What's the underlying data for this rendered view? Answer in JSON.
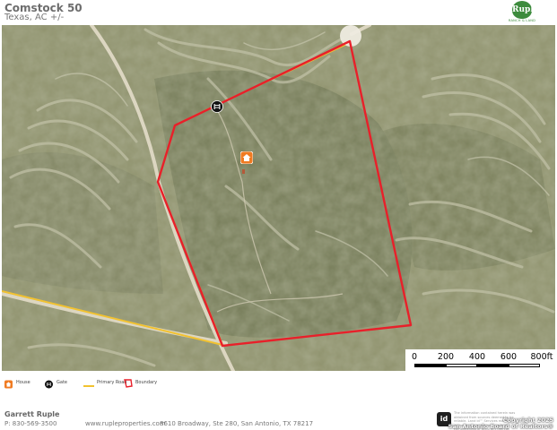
{
  "header": {
    "title": "Comstock 50",
    "subtitle": "Texas,  AC +/-",
    "logo_mark": "Ruple",
    "logo_sub": "RANCH & LAND"
  },
  "map": {
    "scale_labels": [
      "0",
      "200",
      "400",
      "600",
      "800ft"
    ],
    "markers": [
      {
        "type": "house",
        "icon": "house-icon"
      },
      {
        "type": "gate",
        "icon": "gate-icon"
      }
    ]
  },
  "legend": {
    "items": [
      {
        "icon": "house-icon",
        "label": "House"
      },
      {
        "icon": "gate-icon",
        "label": "Gate"
      },
      {
        "icon": "primary-road-icon",
        "label": "Primary Road"
      },
      {
        "icon": "boundary-icon",
        "label": "Boundary"
      }
    ]
  },
  "footer": {
    "agent_name": "Garrett Ruple",
    "phone": "P: 830-569-3500",
    "website": "www.rupleproperties.com",
    "address": "8610 Broadway, Ste 280, San Antonio, TX 78217",
    "idx_badge": "id",
    "disclaimer": "The information contained herein was obtained from sources deemed to be reliable. Land id™ Services makes no warranties or guarantees as to the completeness or accuracy thereof.",
    "copyright_line1": "Copyright 2025",
    "copyright_line2": "San Antonio Board of Realtors®"
  },
  "colors": {
    "boundary": "#e8202a",
    "primary_road": "#f2c230",
    "house_marker": "#f07b22",
    "gate_marker": "#111111",
    "terrain": "#8c8f6a",
    "logo": "#3d8b3d"
  }
}
